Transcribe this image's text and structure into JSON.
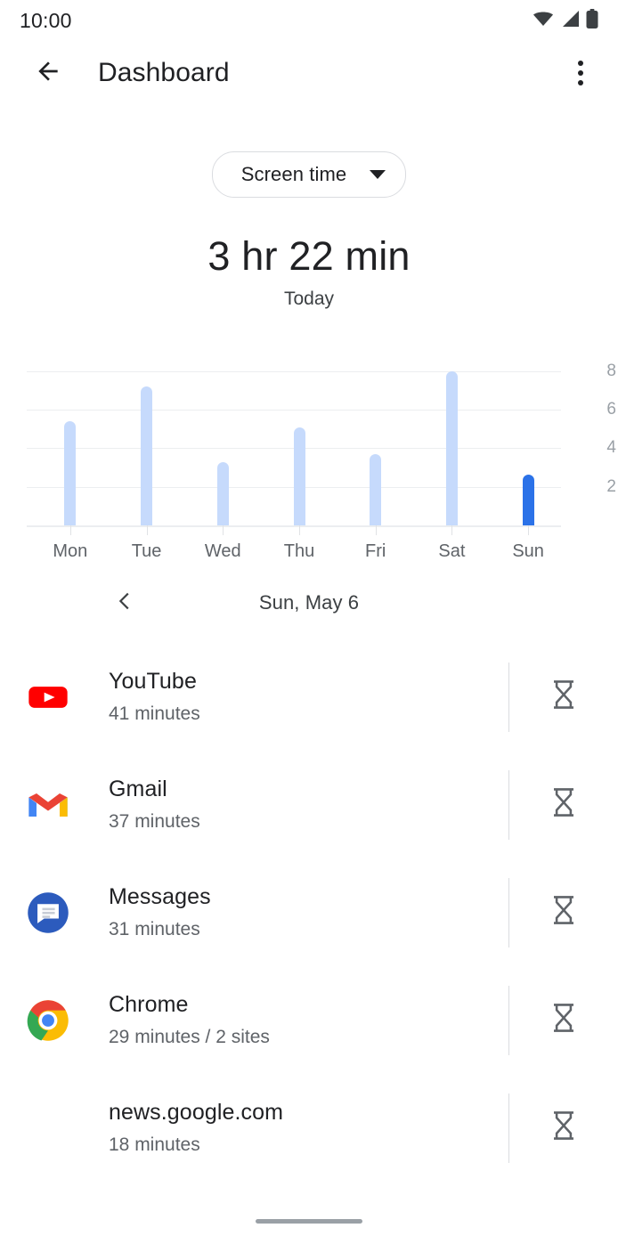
{
  "status_bar": {
    "time": "10:00",
    "icons": [
      "wifi-icon",
      "cell-signal-icon",
      "battery-icon"
    ]
  },
  "app_bar": {
    "back_icon": "arrow-back-icon",
    "title": "Dashboard",
    "overflow_icon": "more-vert-icon"
  },
  "filter_chip": {
    "label": "Screen time",
    "icon": "chevron-down-icon"
  },
  "summary": {
    "total": "3 hr 22 min",
    "period": "Today"
  },
  "date_nav": {
    "prev_icon": "chevron-left-icon",
    "label": "Sun, May 6"
  },
  "colors": {
    "bar": "#c6dafc",
    "bar_active": "#2b72e8",
    "text_primary": "#202124",
    "text_secondary": "#5f6368",
    "divider": "#dadce0"
  },
  "chart_data": {
    "type": "bar",
    "title": "",
    "xlabel": "",
    "ylabel": "",
    "categories": [
      "Mon",
      "Tue",
      "Wed",
      "Thu",
      "Fri",
      "Sat",
      "Sun"
    ],
    "values": [
      5.4,
      7.2,
      3.3,
      5.1,
      3.7,
      8.0,
      2.65
    ],
    "yticks": [
      2,
      4,
      6,
      8
    ],
    "ylim": [
      0,
      8.6
    ],
    "grid": true,
    "legend": false,
    "highlight_index": 6,
    "unit": "hours"
  },
  "app_list": [
    {
      "icon": "youtube-icon",
      "name": "YouTube",
      "usage": "41 minutes",
      "timer_icon": "hourglass-icon"
    },
    {
      "icon": "gmail-icon",
      "name": "Gmail",
      "usage": "37 minutes",
      "timer_icon": "hourglass-icon"
    },
    {
      "icon": "messages-icon",
      "name": "Messages",
      "usage": "31 minutes",
      "timer_icon": "hourglass-icon"
    },
    {
      "icon": "chrome-icon",
      "name": "Chrome",
      "usage": "29 minutes / 2 sites",
      "timer_icon": "hourglass-icon"
    },
    {
      "icon": "none",
      "name": "news.google.com",
      "usage": "18 minutes",
      "timer_icon": "hourglass-icon"
    }
  ]
}
